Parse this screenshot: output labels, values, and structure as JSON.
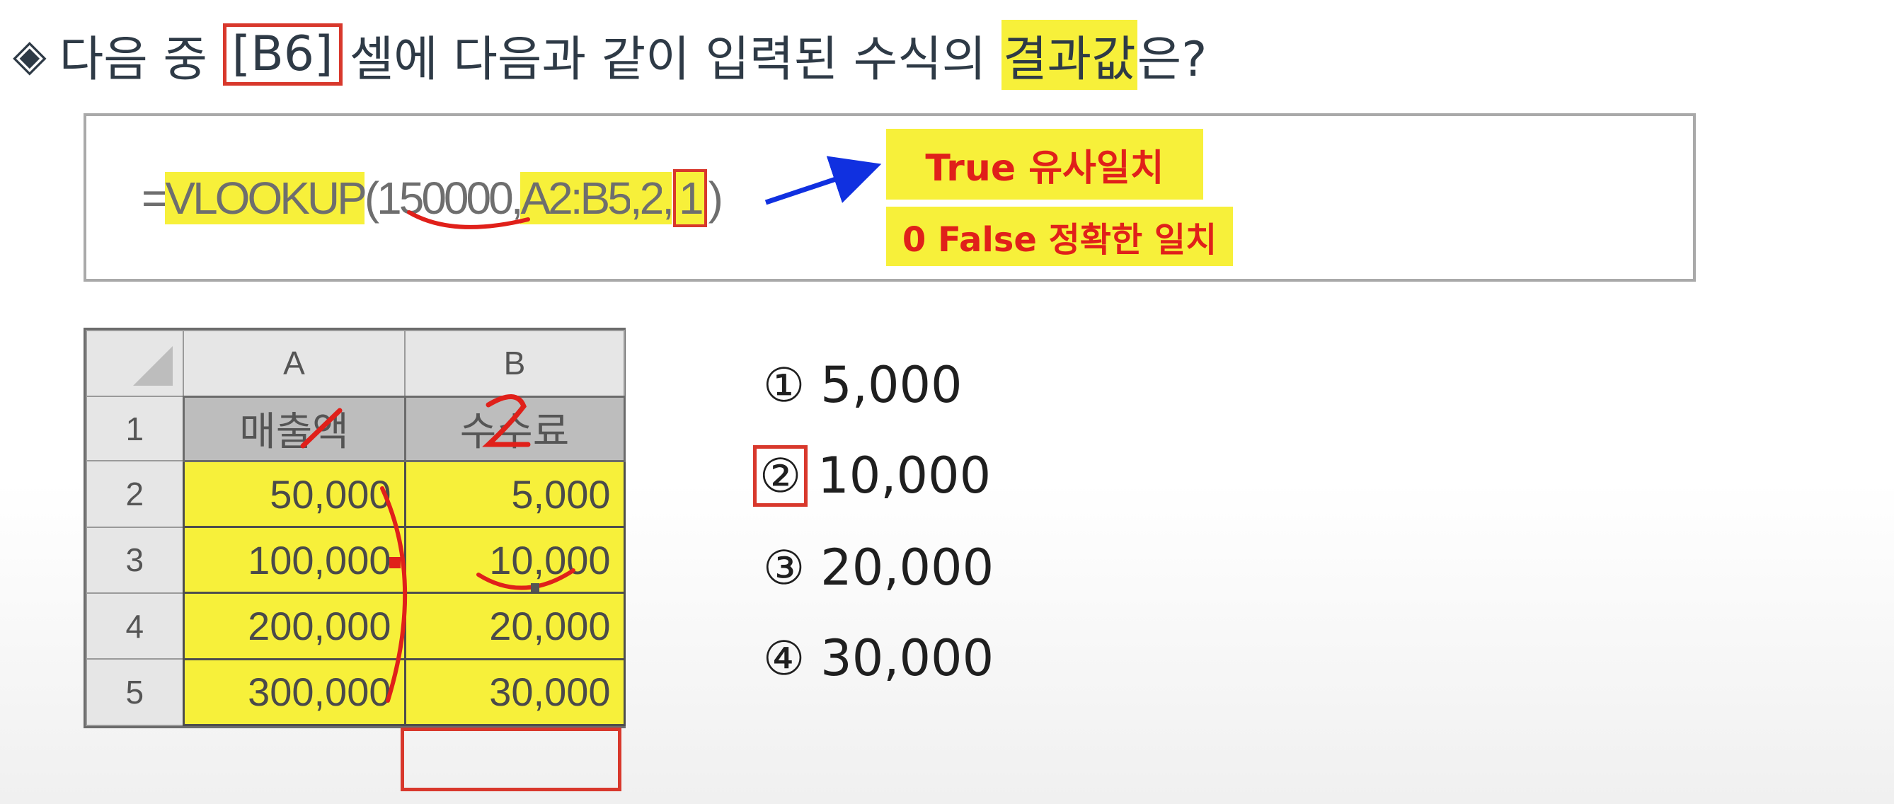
{
  "question": {
    "bullet": "◈",
    "part1": "다음 중",
    "cell_ref": "[B6]",
    "part2": "셀에 다음과 같이 입력된 수식의",
    "highlight": "결과값",
    "part3": "은?"
  },
  "formula": {
    "eq": "=",
    "func": "VLOOKUP",
    "open": "(",
    "arg1": "150000",
    "comma1": ",",
    "range": "A2:B5",
    "comma2": ",",
    "col": "2",
    "comma3": ",",
    "match": "1",
    "close": ")"
  },
  "notes": {
    "true_note": "True  유사일치",
    "false_note": "0 False 정확한 일치"
  },
  "sheet": {
    "col_headers": [
      "A",
      "B"
    ],
    "rows": [
      {
        "row": "1",
        "a": "매출액",
        "b": "수수료"
      },
      {
        "row": "2",
        "a": "50,000",
        "b": "5,000"
      },
      {
        "row": "3",
        "a": "100,000",
        "b": "10,000"
      },
      {
        "row": "4",
        "a": "200,000",
        "b": "20,000"
      },
      {
        "row": "5",
        "a": "300,000",
        "b": "30,000"
      }
    ]
  },
  "choices": [
    {
      "mark": "①",
      "value": "5,000"
    },
    {
      "mark": "②",
      "value": "10,000"
    },
    {
      "mark": "③",
      "value": "20,000"
    },
    {
      "mark": "④",
      "value": "30,000"
    }
  ],
  "colors": {
    "highlight": "#f7f03a",
    "annotation_red": "#d8382c",
    "arrow_blue": "#1030e0"
  }
}
